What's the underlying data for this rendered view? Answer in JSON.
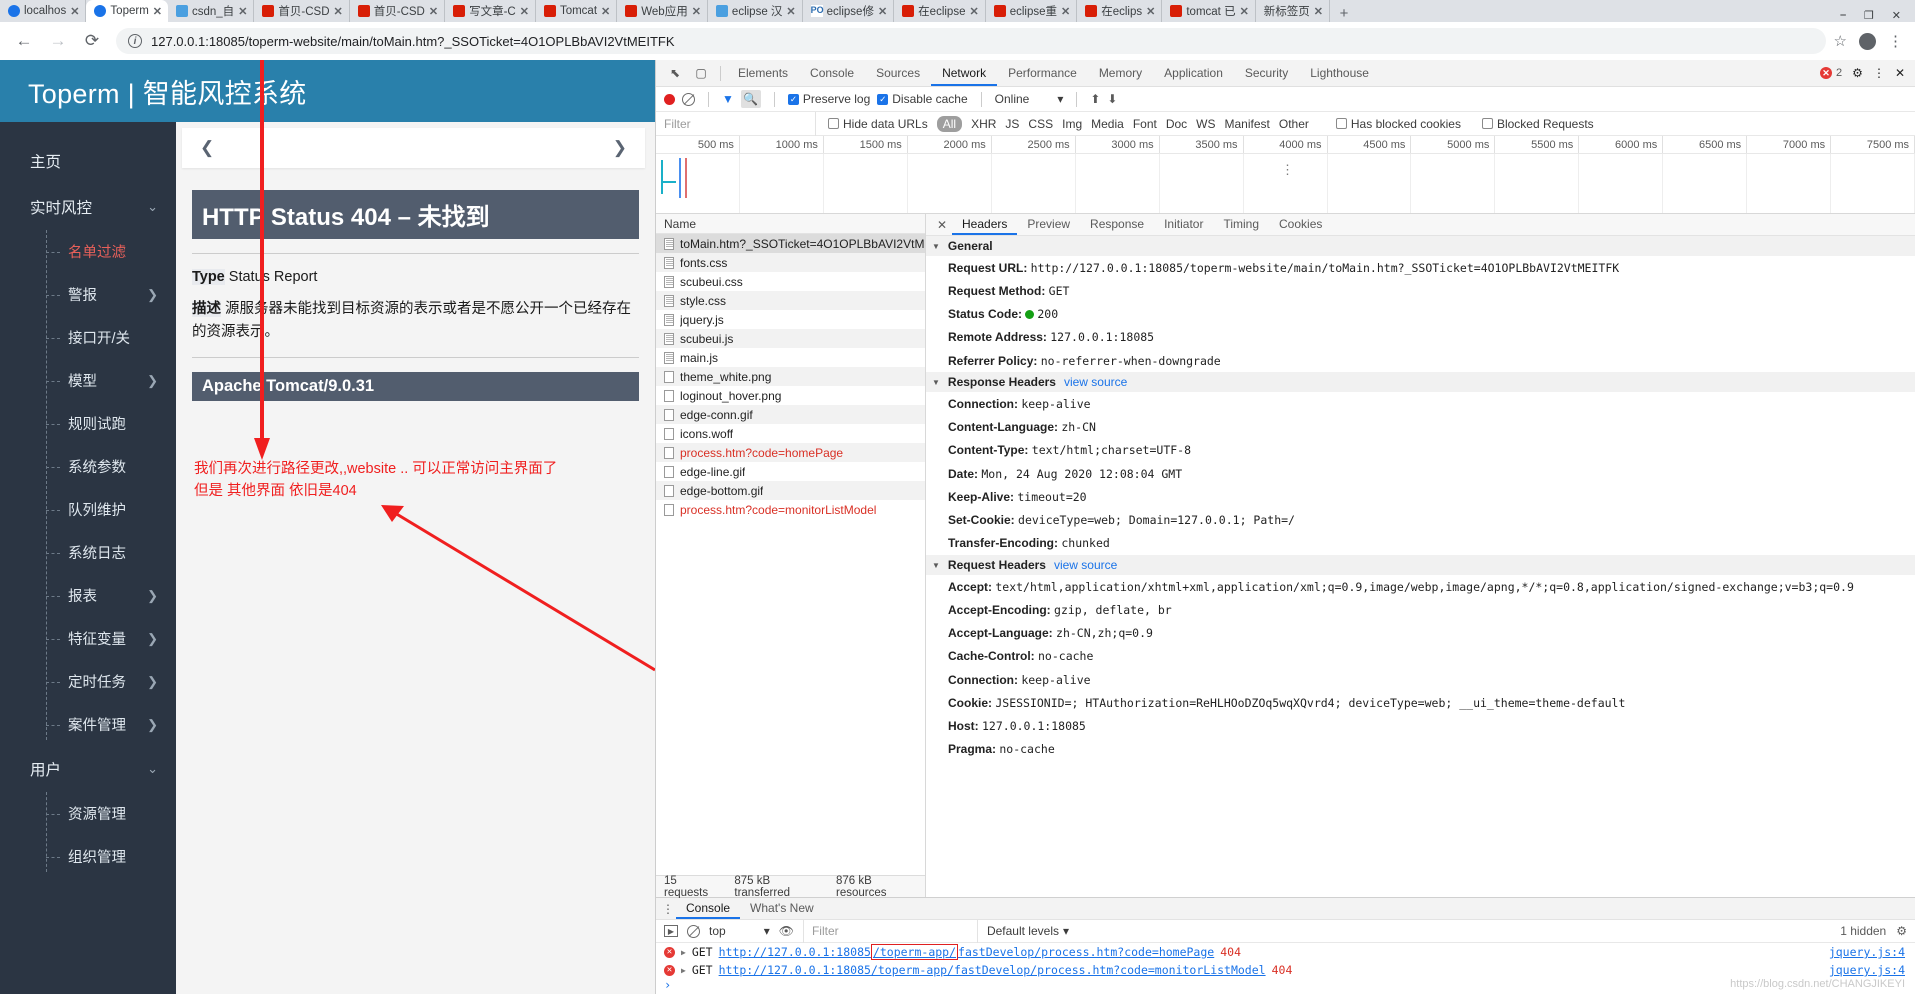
{
  "browser": {
    "tabs": [
      {
        "label": "localhos",
        "favicon": "globe",
        "active": false
      },
      {
        "label": "Toperm",
        "favicon": "globe",
        "active": true
      },
      {
        "label": "csdn_自",
        "favicon": "csdn",
        "active": false
      },
      {
        "label": "首贝-CSD",
        "favicon": "csdn-red",
        "active": false
      },
      {
        "label": "首贝-CSD",
        "favicon": "csdn-red",
        "active": false
      },
      {
        "label": "写文章-C",
        "favicon": "csdn-red",
        "active": false
      },
      {
        "label": "Tomcat",
        "favicon": "csdn-red",
        "active": false
      },
      {
        "label": "Web应用",
        "favicon": "csdn-red",
        "active": false
      },
      {
        "label": "eclipse 汉",
        "favicon": "csdn",
        "active": false
      },
      {
        "label": "eclipse修",
        "favicon": "po",
        "active": false
      },
      {
        "label": "在eclipse",
        "favicon": "csdn-red",
        "active": false
      },
      {
        "label": "eclipse重",
        "favicon": "csdn-red",
        "active": false
      },
      {
        "label": "在eclips",
        "favicon": "csdn-red",
        "active": false
      },
      {
        "label": "tomcat 已",
        "favicon": "csdn-red",
        "active": false
      },
      {
        "label": "新标签页",
        "favicon": "none",
        "active": false
      }
    ],
    "newtab_label": "+",
    "close_glyph": "✕",
    "back_glyph": "←",
    "forward_glyph": "→",
    "reload_glyph": "⟳",
    "info_glyph": "i",
    "url": "127.0.0.1:18085/toperm-website/main/toMain.htm?_SSOTicket=4O1OPLBbAVI2VtMEITFK",
    "star_glyph": "☆",
    "menu_glyph": "⋮",
    "win_minimize": "⎯",
    "win_restore": "❐",
    "win_close": "✕"
  },
  "app": {
    "title": "Toperm | 智能风控系统",
    "header_color": "#2980ab",
    "sidebar_color": "#2b3543",
    "active_color": "#e8605a",
    "nav": [
      {
        "label": "主页",
        "type": "top",
        "chevron": ""
      },
      {
        "label": "实时风控",
        "type": "group",
        "chevron": "⌄"
      },
      {
        "label": "名单过滤",
        "type": "sub",
        "chevron": "",
        "active": true
      },
      {
        "label": "警报",
        "type": "sub",
        "chevron": "❯"
      },
      {
        "label": "接口开/关",
        "type": "sub",
        "chevron": ""
      },
      {
        "label": "模型",
        "type": "sub",
        "chevron": "❯"
      },
      {
        "label": "规则试跑",
        "type": "sub",
        "chevron": ""
      },
      {
        "label": "系统参数",
        "type": "sub",
        "chevron": ""
      },
      {
        "label": "队列维护",
        "type": "sub",
        "chevron": ""
      },
      {
        "label": "系统日志",
        "type": "sub",
        "chevron": ""
      },
      {
        "label": "报表",
        "type": "sub",
        "chevron": "❯"
      },
      {
        "label": "特征变量",
        "type": "sub",
        "chevron": "❯"
      },
      {
        "label": "定时任务",
        "type": "sub",
        "chevron": "❯"
      },
      {
        "label": "案件管理",
        "type": "sub",
        "chevron": "❯"
      },
      {
        "label": "用户",
        "type": "group",
        "chevron": "⌄"
      },
      {
        "label": "资源管理",
        "type": "sub",
        "chevron": ""
      },
      {
        "label": "组织管理",
        "type": "sub",
        "chevron": ""
      }
    ],
    "breadcrumb_prev": "❮",
    "breadcrumb_next": "❯"
  },
  "error_page": {
    "heading": "HTTP Status 404 – 未找到",
    "type_label": "Type",
    "type_value": "Status Report",
    "desc_label": "描述",
    "desc_value": "源服务器未能找到目标资源的表示或者是不愿公开一个已经存在的资源表示。",
    "footer": "Apache Tomcat/9.0.31"
  },
  "annotation": {
    "line1": "我们再次进行路径更改,,website .. 可以正常访问主界面了",
    "line2": "但是 其他界面 依旧是404",
    "color": "#f01f1f"
  },
  "devtools": {
    "panels": [
      "Elements",
      "Console",
      "Sources",
      "Network",
      "Performance",
      "Memory",
      "Application",
      "Security",
      "Lighthouse"
    ],
    "selected_panel": "Network",
    "error_count": "2",
    "settings_glyph": "⚙",
    "menu_glyph": "⋮",
    "close_glyph": "✕",
    "inspect_glyph": "⬉",
    "device_glyph": "▢",
    "toolbar": {
      "record_title": "record",
      "clear_title": "clear",
      "filter_title": "filter",
      "search_title": "search",
      "preserve_log": "Preserve log",
      "disable_cache": "Disable cache",
      "throttling": "Online",
      "dropdown_glyph": "▾",
      "import_glyph": "⬆",
      "export_glyph": "⬇"
    },
    "filterbar": {
      "placeholder": "Filter",
      "hide_data_urls": "Hide data URLs",
      "types": [
        "All",
        "XHR",
        "JS",
        "CSS",
        "Img",
        "Media",
        "Font",
        "Doc",
        "WS",
        "Manifest",
        "Other"
      ],
      "selected_type": "All",
      "has_blocked_cookies": "Has blocked cookies",
      "blocked_requests": "Blocked Requests"
    },
    "overview_ticks": [
      "500 ms",
      "1000 ms",
      "1500 ms",
      "2000 ms",
      "2500 ms",
      "3000 ms",
      "3500 ms",
      "4000 ms",
      "4500 ms",
      "5000 ms",
      "5500 ms",
      "6000 ms",
      "6500 ms",
      "7000 ms",
      "7500 ms"
    ],
    "requests_header": "Name",
    "requests": [
      {
        "name": "toMain.htm?_SSOTicket=4O1OPLBbAVI2VtMEITFK",
        "icon": "doc",
        "error": false,
        "selected": true
      },
      {
        "name": "fonts.css",
        "icon": "doc",
        "error": false
      },
      {
        "name": "scubeui.css",
        "icon": "doc",
        "error": false
      },
      {
        "name": "style.css",
        "icon": "doc",
        "error": false
      },
      {
        "name": "jquery.js",
        "icon": "doc",
        "error": false
      },
      {
        "name": "scubeui.js",
        "icon": "doc",
        "error": false
      },
      {
        "name": "main.js",
        "icon": "doc",
        "error": false
      },
      {
        "name": "theme_white.png",
        "icon": "img",
        "error": false
      },
      {
        "name": "loginout_hover.png",
        "icon": "img",
        "error": false
      },
      {
        "name": "edge-conn.gif",
        "icon": "img",
        "error": false
      },
      {
        "name": "icons.woff",
        "icon": "img",
        "error": false
      },
      {
        "name": "process.htm?code=homePage",
        "icon": "img",
        "error": true
      },
      {
        "name": "edge-line.gif",
        "icon": "img",
        "error": false
      },
      {
        "name": "edge-bottom.gif",
        "icon": "img",
        "error": false
      },
      {
        "name": "process.htm?code=monitorListModel",
        "icon": "img",
        "error": true
      }
    ],
    "requests_footer": {
      "count": "15 requests",
      "transferred": "875 kB transferred",
      "resources": "876 kB resources"
    },
    "detail_tabs": [
      "Headers",
      "Preview",
      "Response",
      "Initiator",
      "Timing",
      "Cookies"
    ],
    "detail_selected": "Headers",
    "sections": [
      {
        "title": "General",
        "view_source": "",
        "rows": [
          {
            "k": "Request URL:",
            "v": "http://127.0.0.1:18085/toperm-website/main/toMain.htm?_SSOTicket=4O1OPLBbAVI2VtMEITFK"
          },
          {
            "k": "Request Method:",
            "v": "GET"
          },
          {
            "k": "Status Code:",
            "v": "200",
            "status": true
          },
          {
            "k": "Remote Address:",
            "v": "127.0.0.1:18085"
          },
          {
            "k": "Referrer Policy:",
            "v": "no-referrer-when-downgrade"
          }
        ]
      },
      {
        "title": "Response Headers",
        "view_source": "view source",
        "rows": [
          {
            "k": "Connection:",
            "v": "keep-alive"
          },
          {
            "k": "Content-Language:",
            "v": "zh-CN"
          },
          {
            "k": "Content-Type:",
            "v": "text/html;charset=UTF-8"
          },
          {
            "k": "Date:",
            "v": "Mon, 24 Aug 2020 12:08:04 GMT"
          },
          {
            "k": "Keep-Alive:",
            "v": "timeout=20"
          },
          {
            "k": "Set-Cookie:",
            "v": "deviceType=web; Domain=127.0.0.1; Path=/"
          },
          {
            "k": "Transfer-Encoding:",
            "v": "chunked"
          }
        ]
      },
      {
        "title": "Request Headers",
        "view_source": "view source",
        "rows": [
          {
            "k": "Accept:",
            "v": "text/html,application/xhtml+xml,application/xml;q=0.9,image/webp,image/apng,*/*;q=0.8,application/signed-exchange;v=b3;q=0.9"
          },
          {
            "k": "Accept-Encoding:",
            "v": "gzip, deflate, br"
          },
          {
            "k": "Accept-Language:",
            "v": "zh-CN,zh;q=0.9"
          },
          {
            "k": "Cache-Control:",
            "v": "no-cache"
          },
          {
            "k": "Connection:",
            "v": "keep-alive"
          },
          {
            "k": "Cookie:",
            "v": "JSESSIONID=; HTAuthorization=ReHLHOoDZOq5wqXQvrd4; deviceType=web; __ui_theme=theme-default"
          },
          {
            "k": "Host:",
            "v": "127.0.0.1:18085"
          },
          {
            "k": "Pragma:",
            "v": "no-cache"
          }
        ]
      }
    ],
    "drawer": {
      "tabs": [
        "Console",
        "What's New"
      ],
      "selected": "Console",
      "context": "top",
      "filter_placeholder": "Filter",
      "levels": "Default levels",
      "levels_glyph": "▾",
      "hidden": "1 hidden",
      "settings_glyph": "⚙",
      "eye_glyph": "👁",
      "messages": [
        {
          "method": "GET",
          "url_pre": "http://127.0.0.1:18085",
          "url_hl": "/toperm-app/",
          "url_post": "fastDevelop/process.htm?code=homePage",
          "status": "404",
          "source": "jquery.js:4"
        },
        {
          "method": "GET",
          "url_pre": "http://127.0.0.1:18085",
          "url_hl": "",
          "url_post": "/toperm-app/fastDevelop/process.htm?code=monitorListModel",
          "status": "404",
          "source": "jquery.js:4"
        }
      ],
      "prompt": "›"
    }
  },
  "watermark": "https://blog.csdn.net/CHANGJIKEYI"
}
